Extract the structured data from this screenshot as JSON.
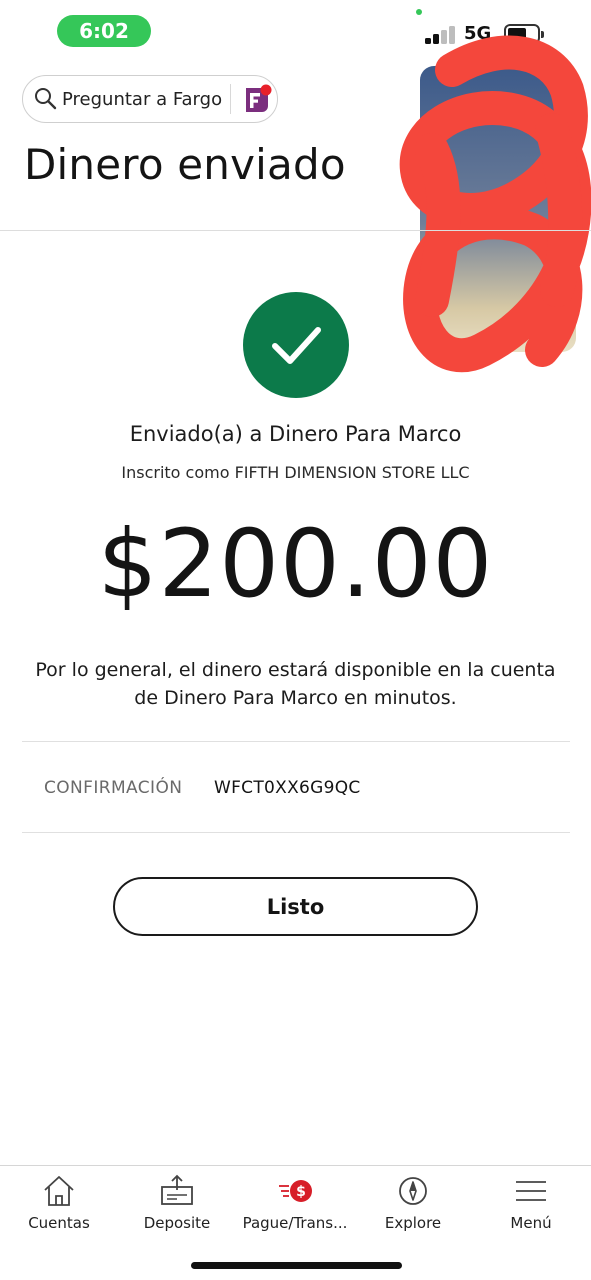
{
  "status_bar": {
    "time": "6:02",
    "network": "5G",
    "colors": {
      "time_pill": "#35c759"
    }
  },
  "search": {
    "placeholder": "Preguntar a Fargo",
    "icon": "search-icon",
    "assistant_icon": "fargo-icon"
  },
  "header": {
    "title": "Dinero enviado"
  },
  "confirmation": {
    "status_icon": "checkmark-icon",
    "sent_to": "Enviado(a) a Dinero Para Marco",
    "enrolled_as": "Inscrito como FIFTH DIMENSION STORE LLC",
    "amount": "$200.00",
    "availability_message": "Por lo general, el dinero estará disponible en la cuenta de Dinero Para Marco en minutos.",
    "confirmation_label": "CONFIRMACIÓN",
    "confirmation_number": "WFCT0XX6G9QC",
    "done_label": "Listo",
    "colors": {
      "success": "#0c7a4a",
      "pay_transfer_accent": "#d71e28"
    }
  },
  "bottom_nav": {
    "items": [
      {
        "label": "Cuentas",
        "icon": "home-icon"
      },
      {
        "label": "Deposite",
        "icon": "deposit-icon"
      },
      {
        "label": "Pague/Trans...",
        "icon": "pay-transfer-icon"
      },
      {
        "label": "Explore",
        "icon": "compass-icon"
      },
      {
        "label": "Menú",
        "icon": "hamburger-menu-icon"
      }
    ]
  }
}
